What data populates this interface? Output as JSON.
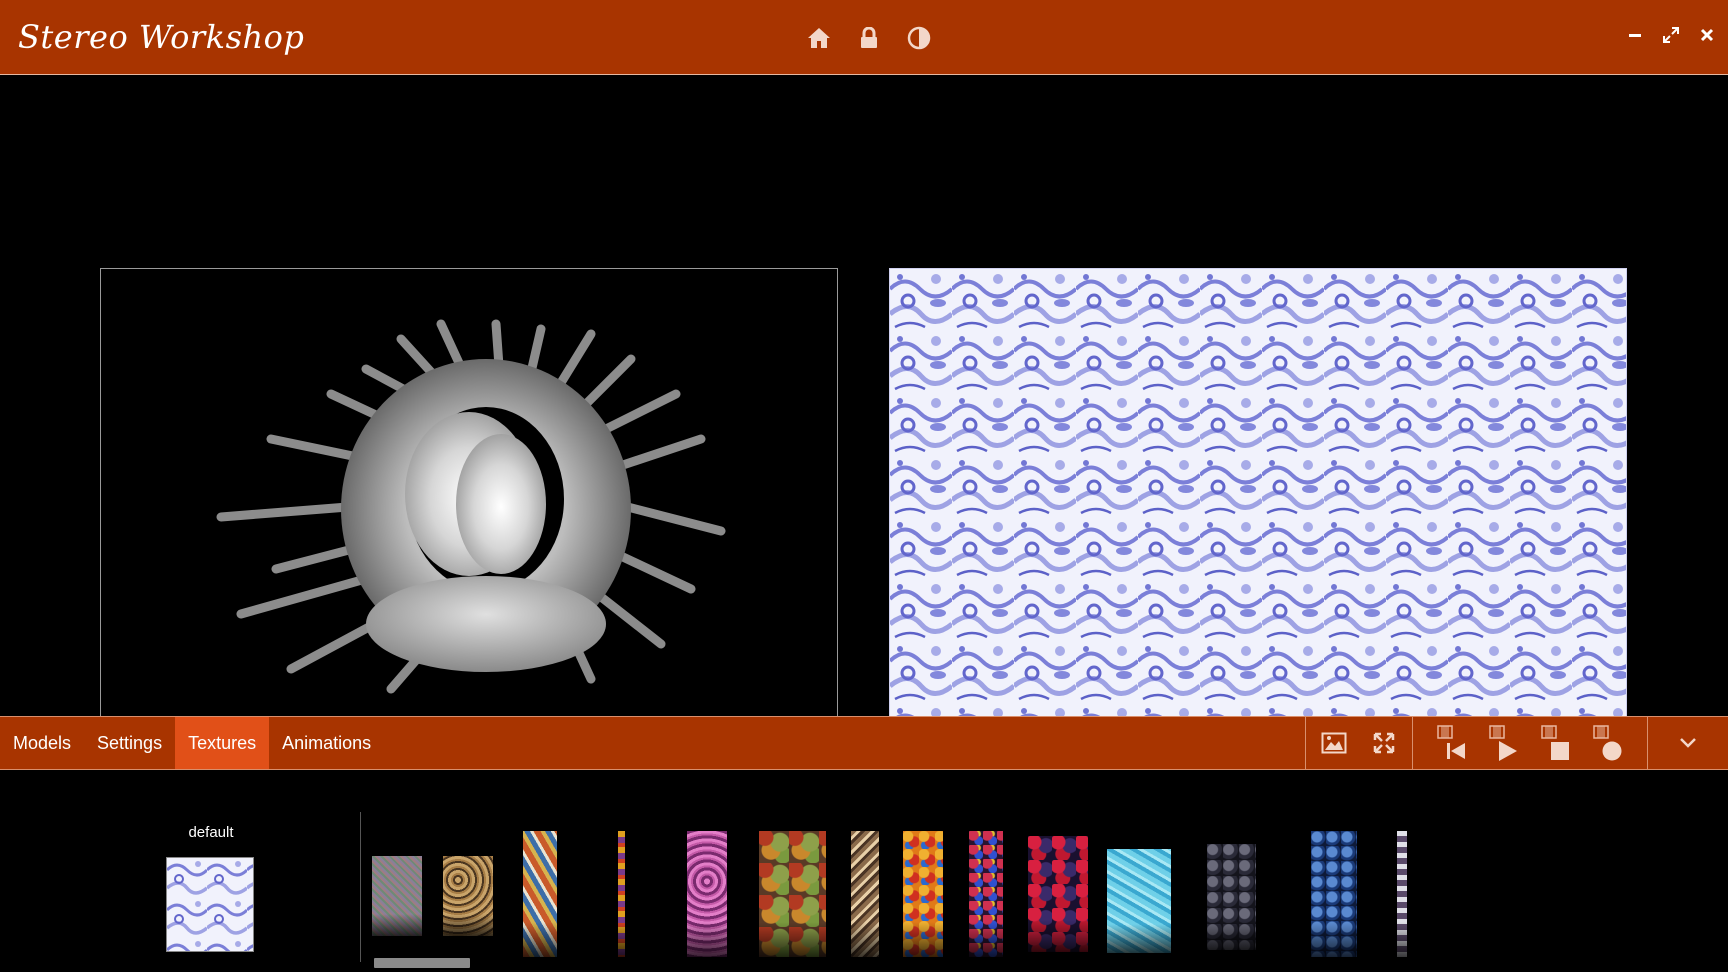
{
  "app": {
    "title": "Stereo Workshop",
    "accent_color": "#a83400",
    "active_tab_color": "#e15018"
  },
  "titlebar": {
    "center_icons": [
      "home-icon",
      "lock-icon",
      "contrast-icon"
    ],
    "window_controls": [
      "minimize-icon",
      "maximize-icon",
      "close-icon"
    ]
  },
  "tabs": [
    {
      "label": "Models",
      "active": false
    },
    {
      "label": "Settings",
      "active": false
    },
    {
      "label": "Textures",
      "active": true
    },
    {
      "label": "Animations",
      "active": false
    }
  ],
  "toolbar_icons": {
    "view": [
      "image-icon",
      "fullscreen-icon"
    ],
    "media": [
      "film-rewind-icon",
      "film-play-icon",
      "film-stop-icon",
      "film-record-icon"
    ],
    "menu": "chevron-down-icon"
  },
  "textures": {
    "default_label": "default",
    "items": [
      "noise",
      "leopard",
      "stained-glass",
      "thin-strip",
      "pink-crystals",
      "eggs",
      "ornament",
      "gems",
      "beads",
      "berries",
      "ice",
      "dark-balls",
      "blueberries",
      "partial"
    ]
  }
}
